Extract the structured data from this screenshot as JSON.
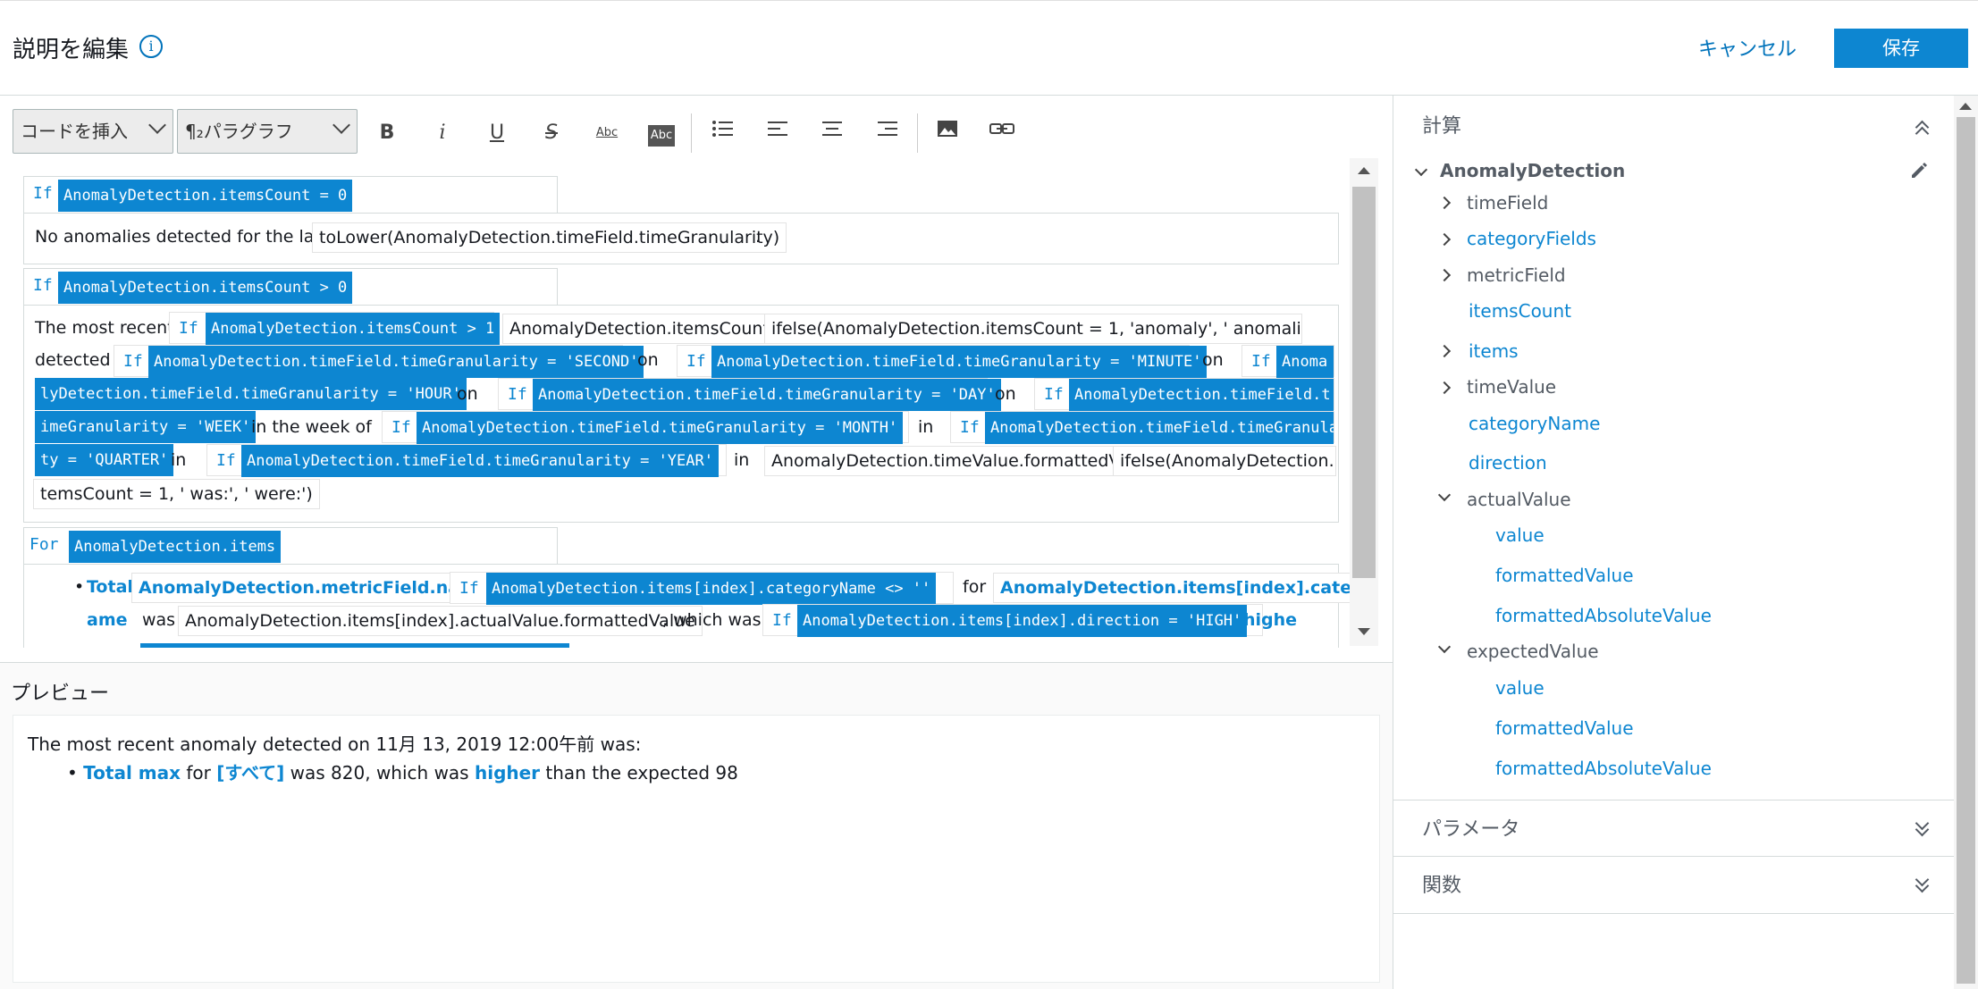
{
  "header": {
    "title": "説明を編集",
    "info_icon": "i",
    "cancel_label": "キャンセル",
    "save_label": "保存"
  },
  "toolbar": {
    "insert_code": "コードを挿入",
    "paragraph": "¶₂パラグラフ",
    "bold": "B",
    "italic": "i",
    "underline": "U",
    "strike": "S",
    "spell": "Abc",
    "highlight": "Abc"
  },
  "editor": {
    "if": "If",
    "for": "For",
    "block1_cond": "AnomalyDetection.itemsCount = 0",
    "block1_text": "No anomalies detected for the last",
    "block1_expr": "toLower(AnomalyDetection.timeField.timeGranularity)",
    "block1_end": ".",
    "block2_cond": "AnomalyDetection.itemsCount > 0",
    "b2_most_recent": "The most recent",
    "b2_cond_gt1": "AnomalyDetection.itemsCount > 1",
    "b2_items_count": "AnomalyDetection.itemsCount",
    "b2_ifelse1": "ifelse(AnomalyDetection.itemsCount = 1, 'anomaly', ' anomali…",
    "b2_detected": "detected",
    "b2_second": "AnomalyDetection.timeField.timeGranularity = 'SECOND'",
    "on": "on",
    "b2_minute": "AnomalyDetection.timeField.timeGranularity = 'MINUTE'",
    "b2_hour_a": "Anoma",
    "b2_hour_b": "lyDetection.timeField.timeGranularity = 'HOUR'",
    "b2_day": "AnomalyDetection.timeField.timeGranularity = 'DAY'",
    "b2_week_a": "AnomalyDetection.timeField.t",
    "b2_week_b": "imeGranularity = 'WEEK'",
    "in_week_of": "in the week of",
    "b2_month": "AnomalyDetection.timeField.timeGranularity = 'MONTH'",
    "in": "in",
    "b2_quarter_a": "AnomalyDetection.timeField.timeGranulari",
    "b2_quarter_b": "ty = 'QUARTER'",
    "b2_year": "AnomalyDetection.timeField.timeGranularity = 'YEAR'",
    "b2_formatted": "AnomalyDetection.timeValue.formattedValue",
    "b2_ifelse2_a": "ifelse(AnomalyDetection.i",
    "b2_ifelse2_b": "temsCount = 1, ' was:', ' were:')",
    "block3_cond": "AnomalyDetection.items",
    "b3_total": "Total",
    "b3_metric": "AnomalyDetection.metricField.name",
    "b3_cat_cond": "AnomalyDetection.items[index].categoryName <> ''",
    "for_word": "for",
    "b3_cat_a": "AnomalyDetection.items[index].categoryN",
    "b3_cat_b": "ame",
    "was": "was",
    "b3_actual": "AnomalyDetection.items[index].actualValue.formattedValue",
    "which_was": ", which was",
    "b3_dir": "AnomalyDetection.items[index].direction = 'HIGH'",
    "b3_higher": "highe"
  },
  "preview": {
    "title": "プレビュー",
    "line1": "The most recent anomaly detected on 11月 13, 2019 12:00午前 was:",
    "bullet": "•",
    "total_max": "Total max",
    "for": " for ",
    "all": "[すべて]",
    "was_820": " was 820, which was ",
    "higher": "higher",
    "expected": " than the expected 98"
  },
  "right_panel": {
    "calc_title": "計算",
    "root": "AnomalyDetection",
    "items": [
      {
        "label": "timeField"
      },
      {
        "label": "categoryFields"
      },
      {
        "label": "metricField"
      },
      {
        "label": "itemsCount"
      },
      {
        "label": "items"
      },
      {
        "label": "timeValue"
      },
      {
        "label": "categoryName"
      },
      {
        "label": "direction"
      },
      {
        "label": "actualValue"
      },
      {
        "label": "value"
      },
      {
        "label": "formattedValue"
      },
      {
        "label": "formattedAbsoluteValue"
      },
      {
        "label": "expectedValue"
      },
      {
        "label": "value"
      },
      {
        "label": "formattedValue"
      },
      {
        "label": "formattedAbsoluteValue"
      }
    ],
    "params_title": "パラメータ",
    "funcs_title": "関数"
  },
  "colors": {
    "accent": "#0d86d1",
    "link": "#0073bb"
  }
}
